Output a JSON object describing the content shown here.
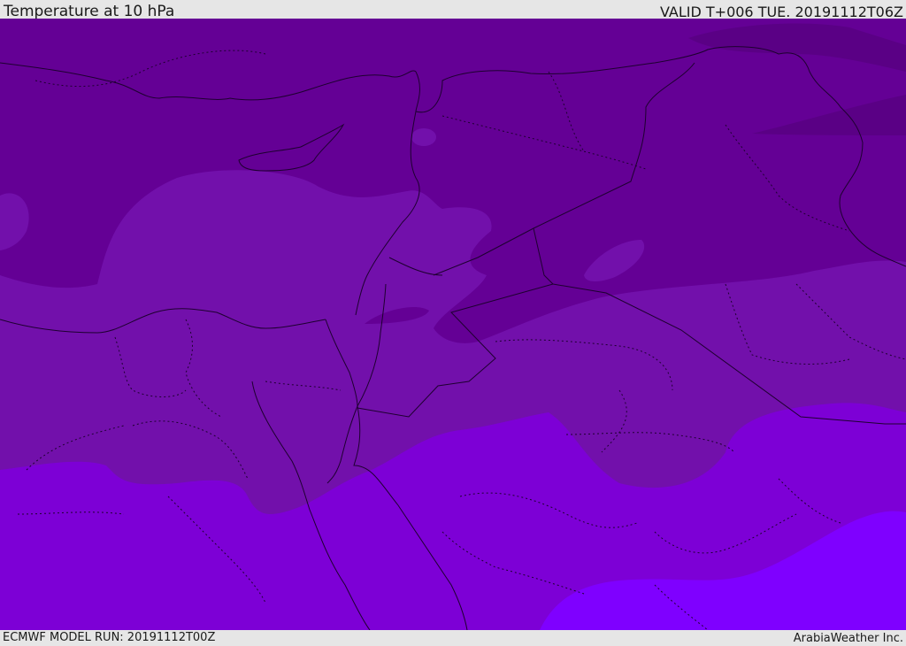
{
  "header": {
    "title": "Temperature at 10 hPa",
    "valid": "VALID T+006 TUE. 20191112T06Z"
  },
  "footer": {
    "model_run": "ECMWF MODEL RUN: 20191112T00Z",
    "credit": "ArabiaWeather Inc."
  },
  "map": {
    "palette": {
      "darkest": "#5a0085",
      "dark": "#640095",
      "mid": "#7210ab",
      "light": "#7d00d6",
      "lightest": "#7f00ff",
      "line": "#1e0030"
    }
  }
}
